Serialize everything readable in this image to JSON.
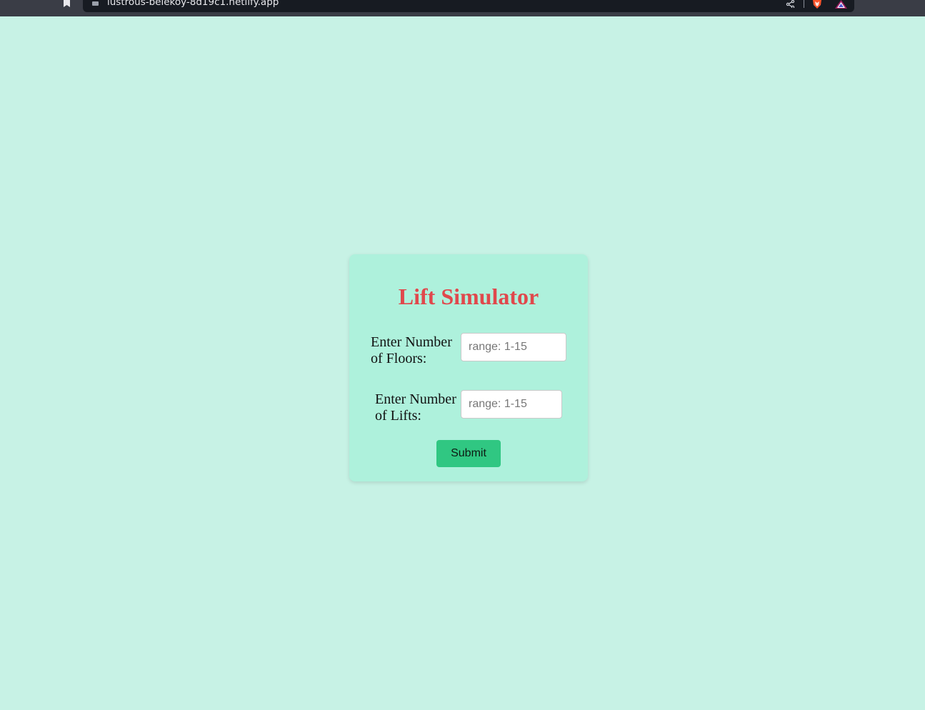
{
  "browser": {
    "url": "lustrous-belekoy-8d19c1.netlify.app",
    "icons": [
      "bookmark-icon",
      "lock-icon",
      "share-icon",
      "brave-shields-icon",
      "brave-rewards-icon"
    ]
  },
  "app": {
    "title": "Lift Simulator",
    "title_color": "#e0484c",
    "background_color": "#c7f2e5",
    "card_color": "#aef1dc",
    "floors": {
      "label": "Enter Number of Floors:",
      "placeholder": "range: 1-15",
      "value": ""
    },
    "lifts": {
      "label": "Enter Number of Lifts:",
      "placeholder": "range: 1-15",
      "value": ""
    },
    "submit_label": "Submit",
    "submit_color": "#30c782"
  }
}
